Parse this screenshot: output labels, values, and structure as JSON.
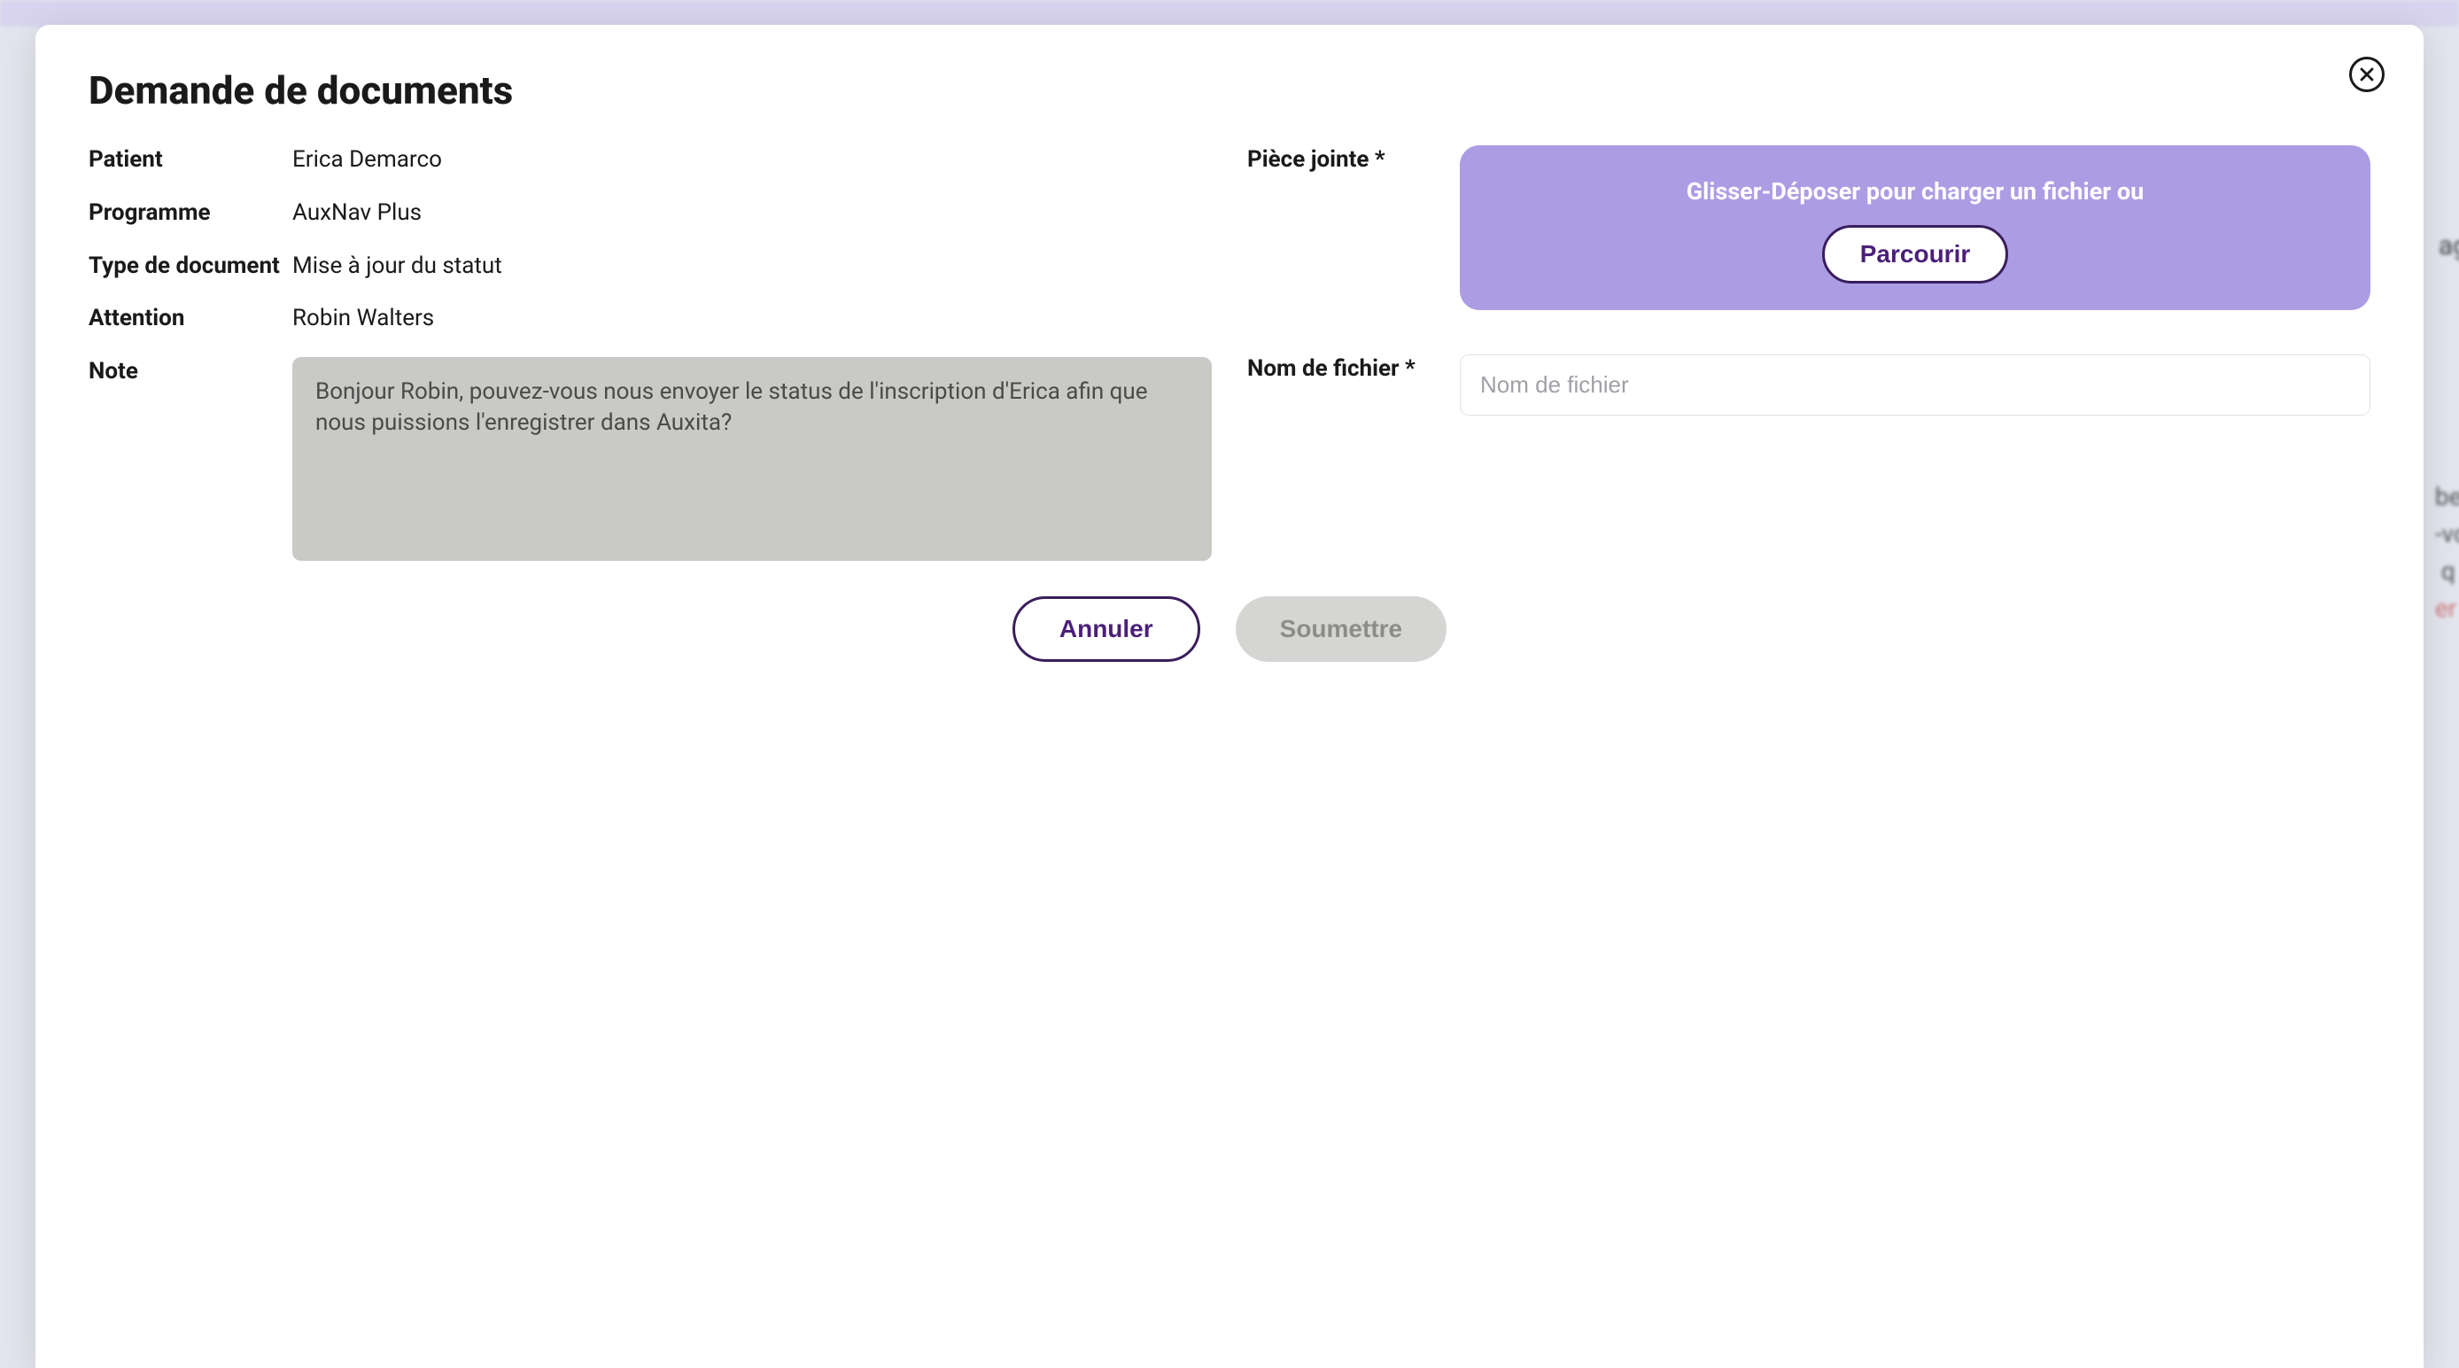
{
  "modal": {
    "title": "Demande de documents",
    "close_label": "Fermer"
  },
  "left": {
    "patient_label": "Patient",
    "patient_value": "Erica Demarco",
    "program_label": "Programme",
    "program_value": "AuxNav Plus",
    "doctype_label": "Type de document",
    "doctype_value": "Mise à jour du statut",
    "attention_label": "Attention",
    "attention_value": "Robin Walters",
    "note_label": "Note",
    "note_value": "Bonjour Robin, pouvez-vous nous envoyer le status de l'inscription d'Erica afin que nous puissions l'enregistrer dans Auxita?"
  },
  "right": {
    "attachment_label": "Pièce jointe *",
    "dropzone_text": "Glisser-Déposer pour charger un fichier ou",
    "browse_label": "Parcourir",
    "filename_label": "Nom de fichier *",
    "filename_placeholder": "Nom de fichier",
    "filename_value": ""
  },
  "actions": {
    "cancel_label": "Annuler",
    "submit_label": "Soumettre"
  },
  "colors": {
    "accent_purple": "#ac9ce4",
    "deep_purple": "#4b1f7a",
    "border_purple": "#3a1e5c"
  }
}
